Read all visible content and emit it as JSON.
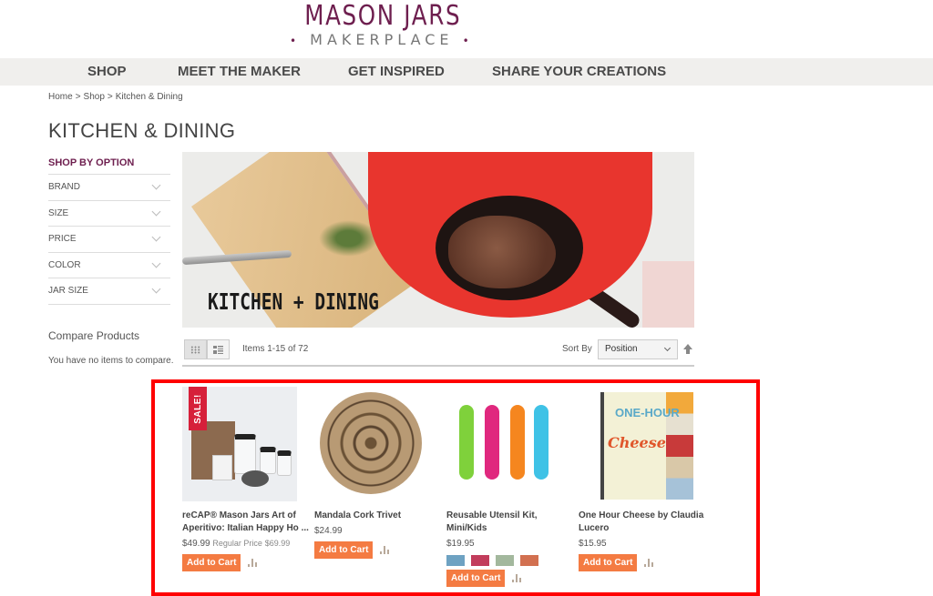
{
  "logo": {
    "main": "MASON JARS",
    "sub": "MAKERPLACE"
  },
  "nav": [
    "SHOP",
    "MEET THE MAKER",
    "GET INSPIRED",
    "SHARE YOUR CREATIONS"
  ],
  "breadcrumb": [
    "Home",
    "Shop",
    "Kitchen & Dining"
  ],
  "breadcrumb_sep": ">",
  "page_title": "KITCHEN & DINING",
  "sidebar": {
    "heading": "SHOP BY OPTION",
    "filters": [
      "BRAND",
      "SIZE",
      "PRICE",
      "COLOR",
      "JAR SIZE"
    ]
  },
  "compare": {
    "title": "Compare Products",
    "empty_text": "You have no items to compare."
  },
  "banner": {
    "title": "KITCHEN + DINING"
  },
  "toolbar": {
    "items_count": "Items 1-15 of 72",
    "sort_label": "Sort By",
    "sort_value": "Position",
    "view_modes": [
      "grid",
      "list"
    ],
    "active_view": "grid"
  },
  "products": [
    {
      "name": "reCAP® Mason Jars Art of Aperitivo: Italian Happy Ho ...",
      "name_line1": "reCAP® Mason Jars Art of",
      "name_line2": "Aperitivo: Italian Happy Ho ...",
      "price": "$49.99",
      "regular_price_label": "Regular Price",
      "regular_price": "$69.99",
      "badge": "SALE!",
      "button": "Add to Cart"
    },
    {
      "name": "Mandala Cork Trivet",
      "name_line1": "Mandala Cork Trivet",
      "price": "$24.99",
      "button": "Add to Cart"
    },
    {
      "name": "Reusable Utensil Kit, Mini/Kids",
      "name_line1": "Reusable Utensil Kit,",
      "name_line2": "Mini/Kids",
      "price": "$19.95",
      "swatches": [
        "#6ea2c2",
        "#c23d5c",
        "#a3b89d",
        "#d27050"
      ],
      "button": "Add to Cart"
    },
    {
      "name": "One Hour Cheese by Claudia Lucero",
      "name_line1": "One Hour Cheese by Claudia",
      "name_line2": "Lucero",
      "price": "$15.95",
      "book_title_1": "ONE-HOUR",
      "book_title_2": "Cheese",
      "button": "Add to Cart"
    }
  ],
  "colors": {
    "brand": "#6e1f4f",
    "add_to_cart": "#f47b42",
    "highlight": "#ff0000",
    "sale": "#d6203a"
  }
}
